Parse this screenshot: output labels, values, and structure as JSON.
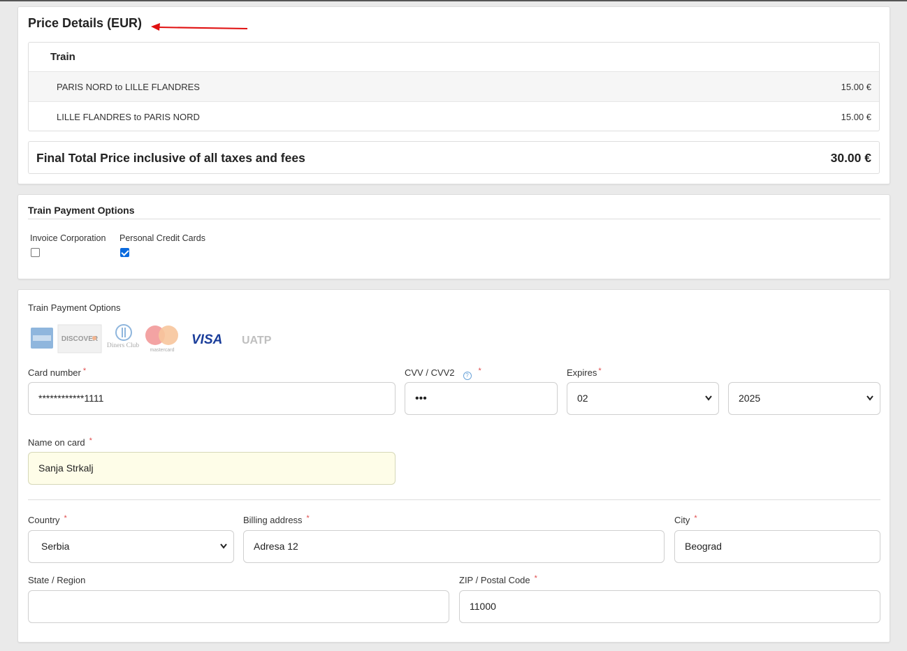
{
  "price": {
    "title": "Price Details (EUR)",
    "section": "Train",
    "segments": [
      {
        "route": "PARIS NORD to LILLE FLANDRES",
        "amount": "15.00 €"
      },
      {
        "route": "LILLE FLANDRES to PARIS NORD",
        "amount": "15.00 €"
      }
    ],
    "total_label": "Final Total Price inclusive of all taxes and fees",
    "total_amount": "30.00 €"
  },
  "options": {
    "title": "Train Payment Options",
    "invoice_label": "Invoice Corporation",
    "invoice_checked": false,
    "personal_label": "Personal Credit Cards",
    "personal_checked": true
  },
  "payment": {
    "title": "Train Payment Options",
    "logos": [
      "amex",
      "DISCOVER",
      "Diners Club",
      "mastercard",
      "VISA",
      "UATP"
    ],
    "card_number_label": "Card number",
    "card_number_value": "************1111",
    "cvv_label": "CVV / CVV2",
    "cvv_value": "•••",
    "expires_label": "Expires",
    "expires_month": "02",
    "expires_year": "2025",
    "name_label": "Name on card",
    "name_value": "Sanja Strkalj",
    "country_label": "Country",
    "country_value": "Serbia",
    "billing_label": "Billing address",
    "billing_value": "Adresa 12",
    "city_label": "City",
    "city_value": "Beograd",
    "state_label": "State / Region",
    "state_value": "",
    "zip_label": "ZIP / Postal Code",
    "zip_value": "11000",
    "required_mark": "*",
    "help_mark": "?"
  },
  "colors": {
    "accent": "#0b6bde",
    "required": "#e04a4a",
    "arrow": "#e01010",
    "visa": "#1a3d9a"
  }
}
